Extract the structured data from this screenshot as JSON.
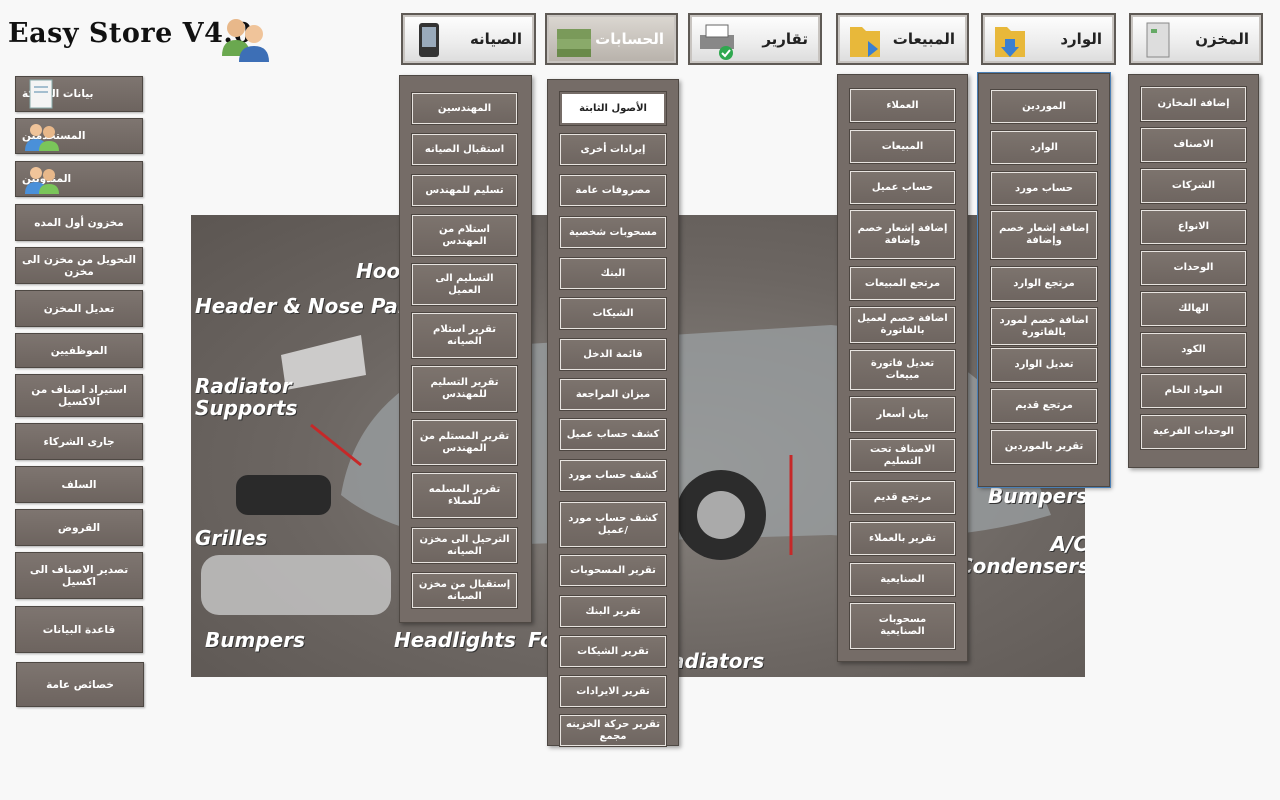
{
  "app": {
    "title": "Easy Store V4.0"
  },
  "top_tabs": [
    {
      "label": "الصيانه",
      "icon": "phone-device-icon"
    },
    {
      "label": "الحسابات",
      "icon": "money-stack-icon"
    },
    {
      "label": "تقارير",
      "icon": "printer-icon"
    },
    {
      "label": "المبيعات",
      "icon": "folder-out-icon"
    },
    {
      "label": "الوارد",
      "icon": "folder-in-icon"
    },
    {
      "label": "المخزن",
      "icon": "storage-cabinet-icon"
    }
  ],
  "menus": {
    "maintenance": [
      "المهندسين",
      "استقبال الصيانه",
      "تسليم للمهندس",
      "استلام من المهندس",
      "التسليم الى العميل",
      "تقرير استلام الصيانه",
      "تقرير التسليم للمهندس",
      "تقرير المستلم من المهندس",
      "تقرير المسلمه للعملاء",
      "الترحيل الى مخزن الصيانه",
      "إستقبال من مخزن الصيانه"
    ],
    "accounts": [
      "الأصول الثابتة",
      "إيرادات أخرى",
      "مصروفات عامة",
      "مسحوبات شخصية",
      "البنك",
      "الشيكات",
      "قائمة الدخل",
      "ميزان المراجعة",
      "كشف حساب عميل",
      "كشف حساب مورد",
      "كشف حساب مورد /عميل",
      "تقرير المسحوبات",
      "تقرير البنك",
      "تقرير الشيكات",
      "تقرير الايرادات",
      "تقرير حركة الخزينه مجمع"
    ],
    "sales": [
      "العملاء",
      "المبيعات",
      "حساب عميل",
      "إضافة إشعار خصم وإضافة",
      "مرتجع المبيعات",
      "اضافة خصم لعميل بالفاتورة",
      "تعديل فاتورة مبيعات",
      "بيان أسعار",
      "الاصناف تحت التسليم",
      "مرتجع قديم",
      "تقرير بالعملاء",
      "الصنايعية",
      "مسحوبات الصنايعية"
    ],
    "incoming": [
      "الموردين",
      "الوارد",
      "حساب مورد",
      "إضافة إشعار خصم وإضافة",
      "مرتجع الوارد",
      "اضافة خصم لمورد بالفاتورة",
      "تعديل الوارد",
      "مرتجع قديم",
      "تقرير بالموردين"
    ],
    "warehouse": [
      "إضافة المخازن",
      "الاصناف",
      "الشركات",
      "الانواع",
      "الوحدات",
      "الهالك",
      "الكود",
      "المواد الخام",
      "الوحدات الفرعية"
    ]
  },
  "sidebar": [
    "بيانات الشركة",
    "المستخدمين",
    "المندوبين",
    "مخزون أول المده",
    "التحويل من مخزن الى مخزن",
    "تعديل المخزن",
    "الموظفيين",
    "استيراد اصناف من الاكسيل",
    "جارى الشركاء",
    "السلف",
    "القروض",
    "تصدير الاصناف الى اكسيل",
    "قاعدة البيانات",
    "خصائص عامة"
  ],
  "background_labels": [
    "Header & Nose Panels",
    "Radiator Supports",
    "Grilles",
    "Bumpers",
    "Headlights",
    "Hoo",
    "Bumpers",
    "A/C Condensers",
    "adiators",
    "Fo"
  ],
  "colors": {
    "button_bg": "#756c67",
    "menu_bg": "#756c67",
    "selected_bg": "#ffffff",
    "page_bg": "#f8f8f8"
  }
}
